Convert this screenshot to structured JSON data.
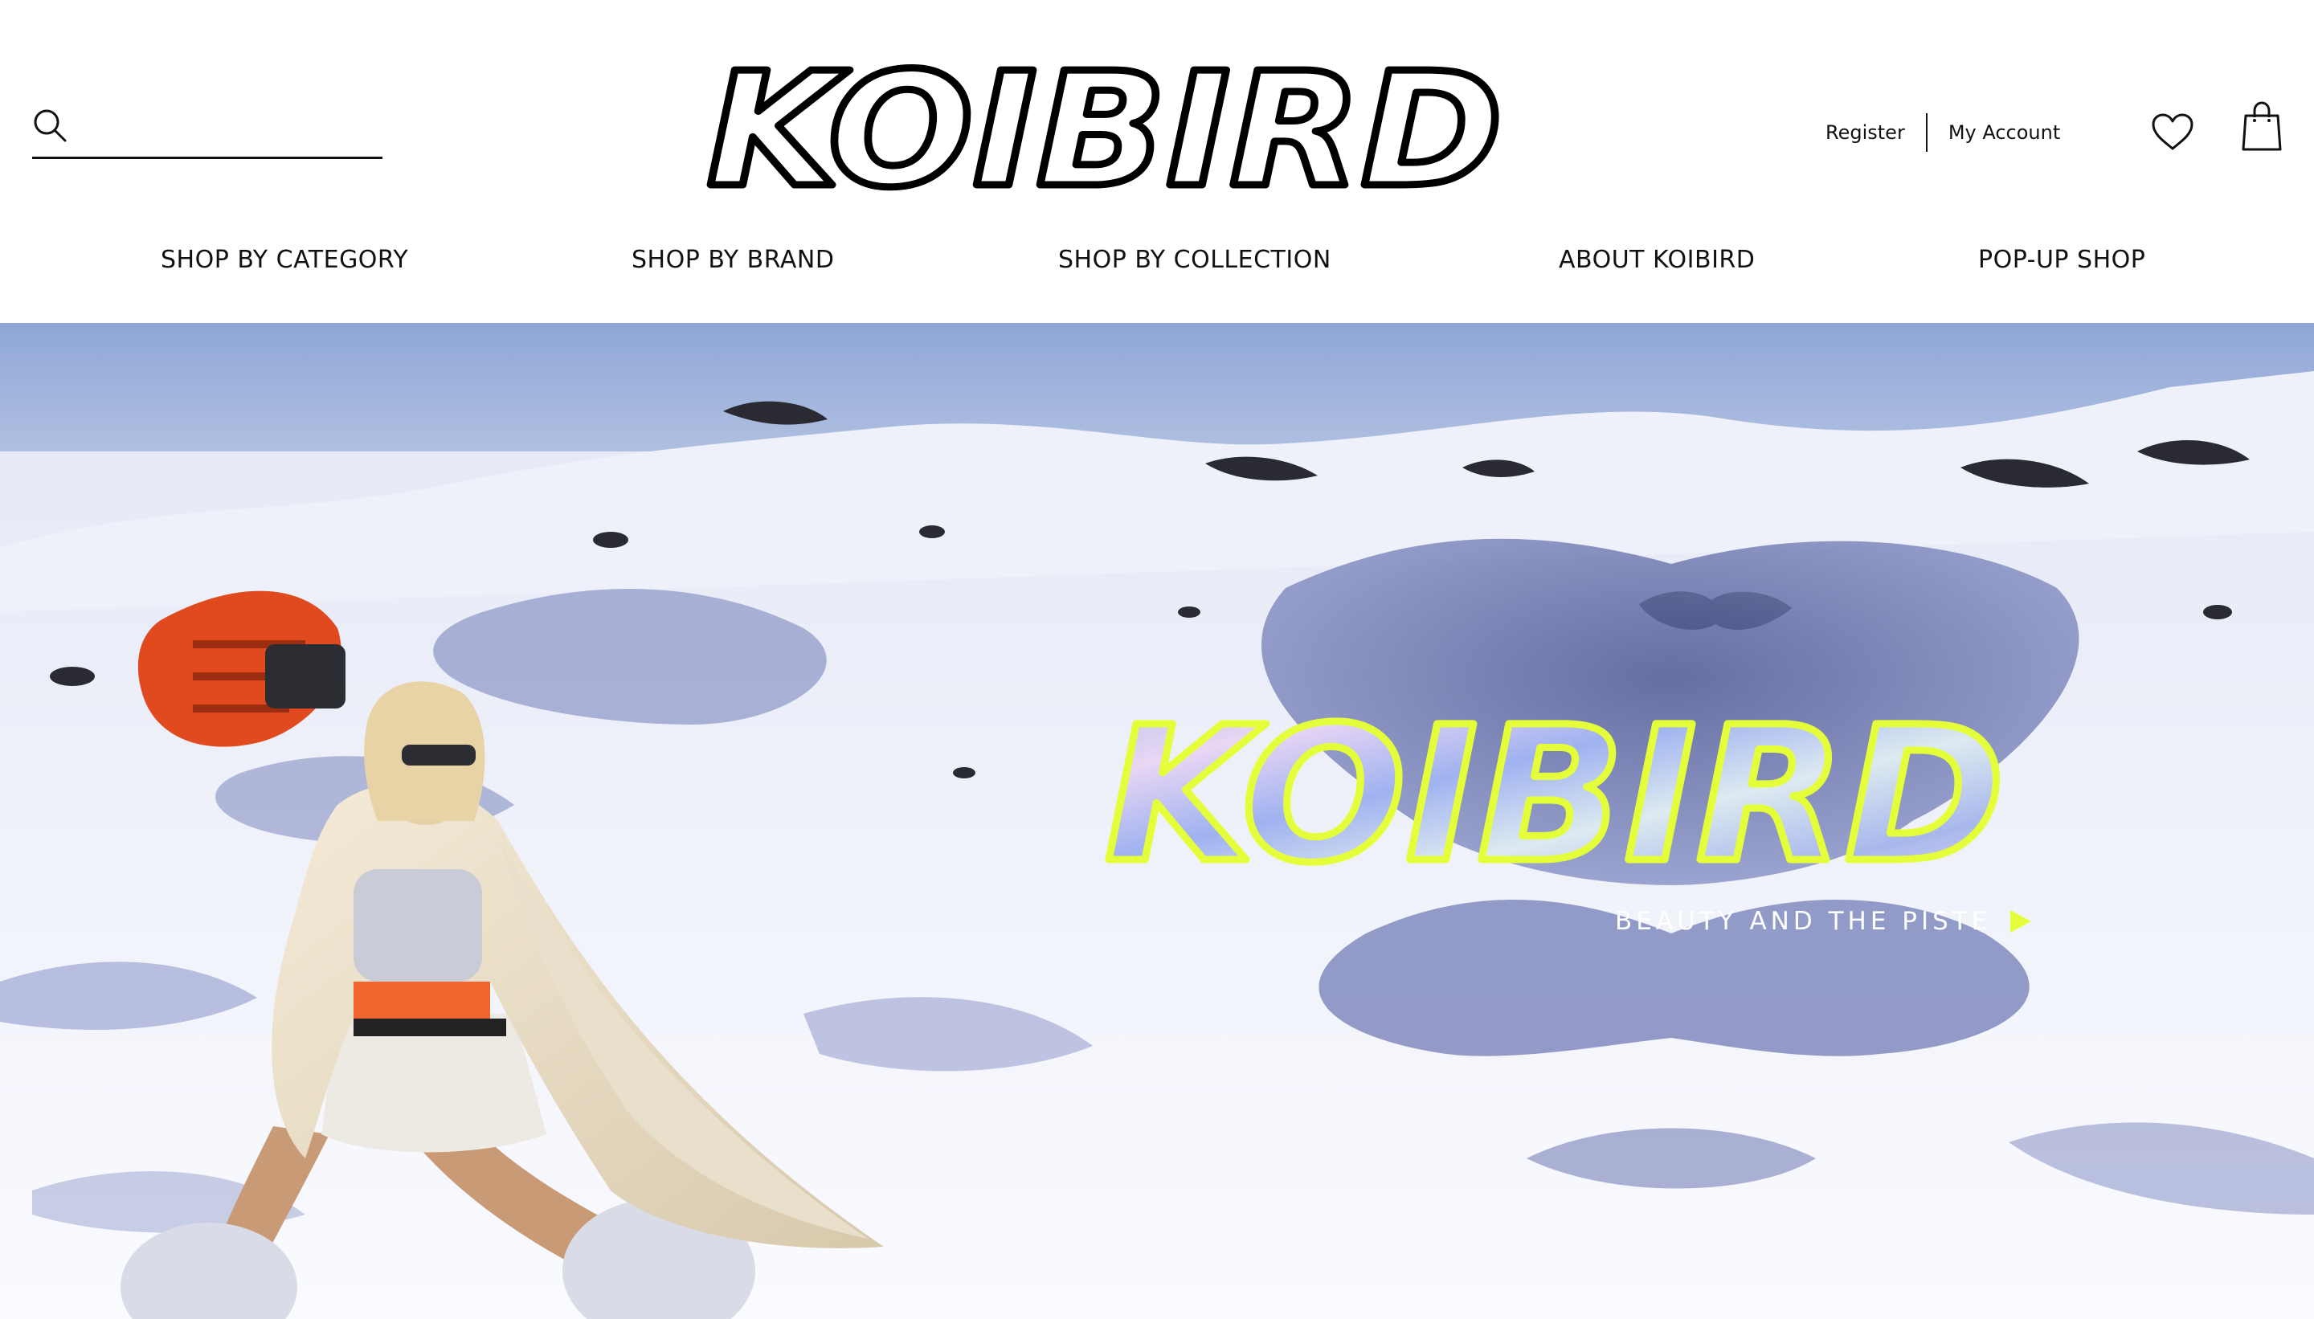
{
  "header": {
    "search": {
      "placeholder": "",
      "icon": "search-icon"
    },
    "logo_text": "KOIBIRD",
    "account": {
      "register_label": "Register",
      "my_account_label": "My Account"
    },
    "icons": {
      "wishlist": "heart-icon",
      "bag": "shopping-bag-icon"
    }
  },
  "nav": {
    "items": [
      {
        "label": "SHOP BY CATEGORY"
      },
      {
        "label": "SHOP BY BRAND"
      },
      {
        "label": "SHOP BY COLLECTION"
      },
      {
        "label": "ABOUT KOIBIRD"
      },
      {
        "label": "POP-UP SHOP"
      }
    ]
  },
  "hero": {
    "logo_text": "KOIBIRD",
    "cta_label": "BEAUTY AND THE PISTE",
    "cta_icon": "play-icon",
    "colors": {
      "accent": "#E4FF3A",
      "sky": "#9EB4DC",
      "snow": "#F2F4FA",
      "shadow": "#5A64A0",
      "board": "#E04A1E"
    }
  }
}
